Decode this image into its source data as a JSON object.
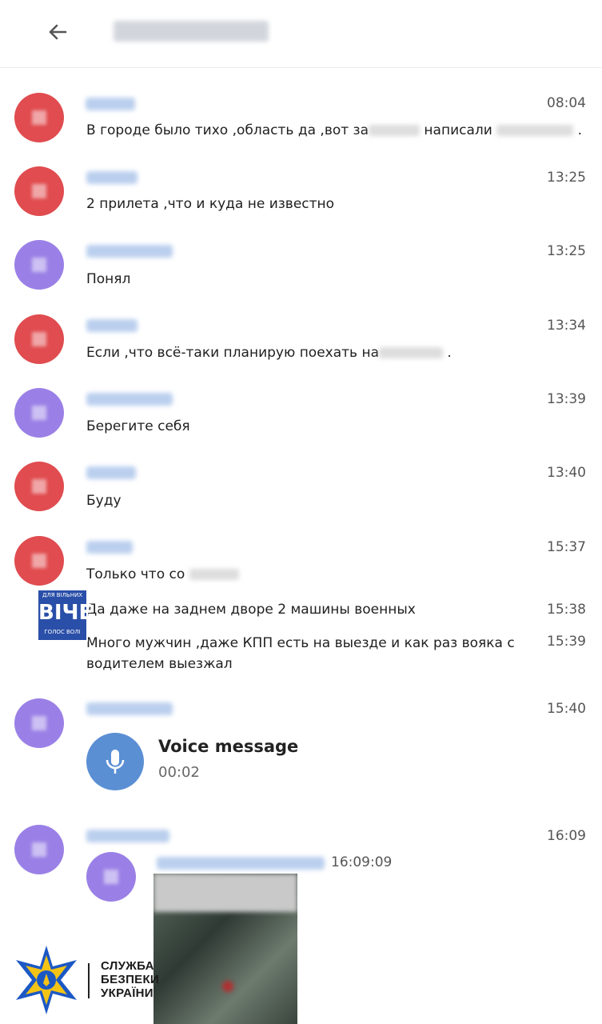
{
  "header": {
    "back_icon": "arrow-left-icon",
    "title_redacted": true
  },
  "messages": [
    {
      "avatar": "red",
      "time": "08:04",
      "text_a": "В городе было тихо ,область да ,вот за",
      "text_b": "написали",
      "text_c": "."
    },
    {
      "avatar": "red",
      "time": "13:25",
      "text": "2 прилета ,что и куда не известно"
    },
    {
      "avatar": "violet",
      "time": "13:25",
      "text": "Понял"
    },
    {
      "avatar": "red",
      "time": "13:34",
      "text_a": "Если ,что всё-таки планирую поехать на",
      "text_c": "."
    },
    {
      "avatar": "violet",
      "time": "13:39",
      "text": "Берегите себя"
    },
    {
      "avatar": "red",
      "time": "13:40",
      "text": "Буду"
    },
    {
      "avatar": "red",
      "time": "15:37",
      "text_a": "Только что со"
    },
    {
      "time": "15:38",
      "text": "Да даже на заднем дворе 2 машины военных"
    },
    {
      "time": "15:39",
      "text_l1": "Много мужчин ,даже КПП есть на выезде и как раз вояка с",
      "text_l2": "водителем выезжал"
    },
    {
      "avatar": "violet",
      "time": "15:40"
    },
    {
      "avatar": "violet",
      "time": "16:09",
      "forward_time": "16:09:09"
    }
  ],
  "voice": {
    "title": "Voice message",
    "duration": "00:02",
    "icon": "microphone-icon"
  },
  "watermark": {
    "top": "ДЛЯ ВІЛЬНИХ",
    "main": "ВІЧЕ",
    "bottom": "ГОЛОС ВОЛІ"
  },
  "sbu": {
    "line1": "СЛУЖБА",
    "line2": "БЕЗПЕКИ",
    "line3": "УКРАЇНИ"
  },
  "colors": {
    "red_avatar": "#e04c4f",
    "violet_avatar": "#9a80e6",
    "voice_button": "#5b8fd4",
    "sender_name": "#a9c3ea"
  }
}
